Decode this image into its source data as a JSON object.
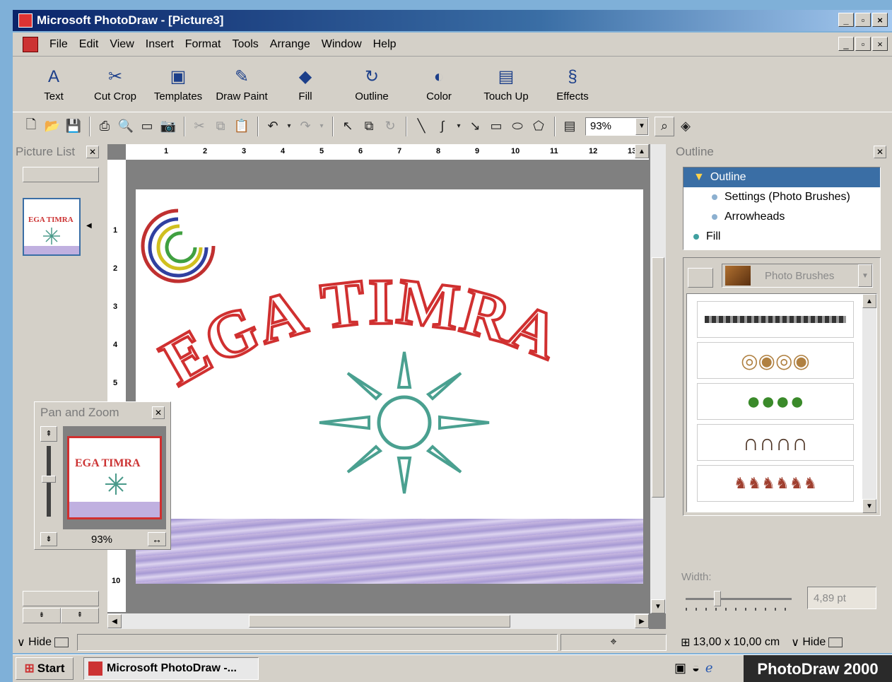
{
  "window": {
    "title": "Microsoft PhotoDraw - [Picture3]",
    "controls": [
      "_",
      "▫",
      "×"
    ]
  },
  "menu": [
    "File",
    "Edit",
    "View",
    "Insert",
    "Format",
    "Tools",
    "Arrange",
    "Window",
    "Help"
  ],
  "big_toolbar": [
    {
      "label": "Text",
      "icon": "text-icon"
    },
    {
      "label": "Cut Crop",
      "icon": "scissors-icon"
    },
    {
      "label": "Templates",
      "icon": "templates-icon"
    },
    {
      "label": "Draw Paint",
      "icon": "draw-paint-icon"
    },
    {
      "label": "Fill",
      "icon": "fill-bucket-icon"
    },
    {
      "label": "Outline",
      "icon": "outline-icon"
    },
    {
      "label": "Color",
      "icon": "color-icon"
    },
    {
      "label": "Touch Up",
      "icon": "touch-up-icon"
    },
    {
      "label": "Effects",
      "icon": "effects-icon"
    }
  ],
  "std_toolbar": {
    "zoom": "93%"
  },
  "picture_list": {
    "title": "Picture List"
  },
  "ruler": {
    "top": [
      "1",
      "2",
      "3",
      "4",
      "5",
      "6",
      "7",
      "8",
      "9",
      "10",
      "11",
      "12",
      "13"
    ],
    "left": [
      "1",
      "2",
      "3",
      "4",
      "5",
      "10"
    ]
  },
  "picture": {
    "headline": "EGA TIMRA"
  },
  "pan_zoom": {
    "title": "Pan and Zoom",
    "zoom": "93%",
    "preview_text": "EGA TIMRA"
  },
  "outline_panel": {
    "title": "Outline",
    "tree": [
      {
        "label": "Outline",
        "selected": true
      },
      {
        "label": "Settings (Photo Brushes)",
        "selected": false
      },
      {
        "label": "Arrowheads",
        "selected": false
      },
      {
        "label": "Fill",
        "selected": false
      }
    ],
    "brush_category": "Photo Brushes",
    "brushes": [
      "chain-brush",
      "donut-brush",
      "green-ball-brush",
      "horseshoe-brush",
      "dog-brush"
    ],
    "width_label": "Width:",
    "width_value": "4,89 pt"
  },
  "statusbar": {
    "hide_left": "Hide",
    "size": "13,00 x 10,00 cm",
    "hide_right": "Hide"
  },
  "taskbar": {
    "start": "Start",
    "task": "Microsoft PhotoDraw -...",
    "brand": "PhotoDraw 2000"
  }
}
